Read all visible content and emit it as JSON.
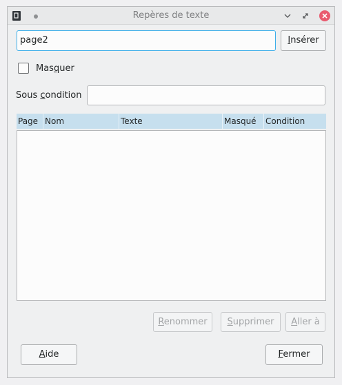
{
  "window": {
    "title": "Repères de texte"
  },
  "bookmark_input": {
    "value": "page2"
  },
  "insert_button": {
    "label_pre": "",
    "label_u": "I",
    "label_post": "nsérer"
  },
  "hide_checkbox": {
    "label_pre": "Mas",
    "label_u": "q",
    "label_post": "uer",
    "checked": false
  },
  "condition": {
    "label_pre": "Sous ",
    "label_u": "c",
    "label_post": "ondition",
    "value": ""
  },
  "table": {
    "columns": [
      "Page",
      "Nom",
      "Texte",
      "Masqué",
      "Condition"
    ],
    "rows": []
  },
  "actions": {
    "rename": {
      "pre": "",
      "u": "R",
      "post": "enommer"
    },
    "delete": {
      "pre": "",
      "u": "S",
      "post": "upprimer"
    },
    "goto": {
      "pre": "",
      "u": "A",
      "post": "ller à"
    }
  },
  "footer": {
    "help": {
      "pre": "",
      "u": "A",
      "post": "ide"
    },
    "close": {
      "pre": "",
      "u": "F",
      "post": "ermer"
    }
  },
  "colors": {
    "accent": "#3daee9",
    "header_bg": "#c6dfee",
    "close_btn": "#e95b6f"
  },
  "icons": [
    "app-document-icon",
    "pin-icon",
    "minimize-icon",
    "maximize-icon",
    "close-icon"
  ]
}
